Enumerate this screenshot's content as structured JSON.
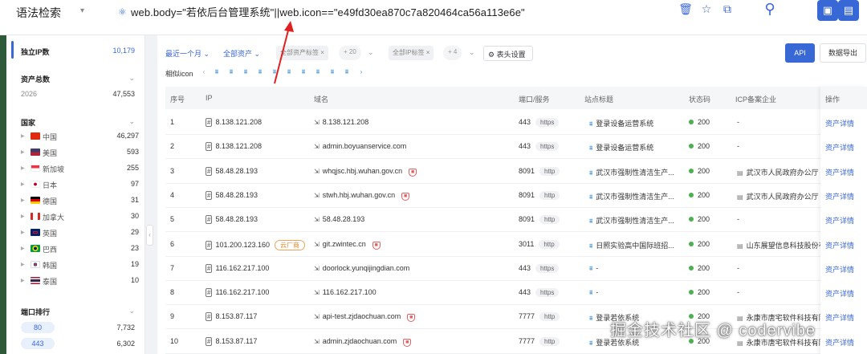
{
  "topbar": {
    "label": "语法检索",
    "query": "web.body=\"若依后台管理系统\"||web.icon==\"e49fd30ea870c7a820464ca56a113e6e\"",
    "icons": [
      "delete-icon",
      "star-icon",
      "copy-icon",
      "search-icon",
      "user-card-icon",
      "document-icon"
    ]
  },
  "sidebar": {
    "unique_ip_label": "独立IP数",
    "unique_ip_value": "10,179",
    "asset_total_label": "资产总数",
    "asset_year": "2026",
    "asset_total_value": "47,553",
    "country_label": "国家",
    "countries": [
      {
        "name": "中国",
        "count": "46,297"
      },
      {
        "name": "美国",
        "count": "593"
      },
      {
        "name": "新加坡",
        "count": "255"
      },
      {
        "name": "日本",
        "count": "97"
      },
      {
        "name": "德国",
        "count": "31"
      },
      {
        "name": "加拿大",
        "count": "30"
      },
      {
        "name": "英国",
        "count": "29"
      },
      {
        "name": "巴西",
        "count": "23"
      },
      {
        "name": "韩国",
        "count": "19"
      },
      {
        "name": "泰国",
        "count": "10"
      }
    ],
    "port_label": "端口排行",
    "ports": [
      {
        "port": "80",
        "count": "7,732"
      },
      {
        "port": "443",
        "count": "6,302"
      }
    ]
  },
  "filters": {
    "time": "最近一个月",
    "asset": "全部资产",
    "asset_tag": "全部资产标签",
    "asset_tag_count": "+ 20",
    "ip_tag": "全部IP标签",
    "ip_tag_count": "+ 4",
    "column_settings": "表头设置",
    "api": "API",
    "export": "数据导出",
    "similar_icon": "相似icon"
  },
  "table": {
    "headers": [
      "序号",
      "IP",
      "域名",
      "端口/服务",
      "站点标题",
      "状态码",
      "ICP备案企业",
      "操作"
    ],
    "rows": [
      {
        "no": "1",
        "ip": "8.138.121.208",
        "cloud": "",
        "domain": "8.138.121.208",
        "shield": false,
        "port": "443",
        "proto": "https",
        "title": "登录设备运营系统",
        "status": "200",
        "icp": "-",
        "action": "资产详情"
      },
      {
        "no": "2",
        "ip": "8.138.121.208",
        "cloud": "",
        "domain": "admin.boyuanservice.com",
        "shield": false,
        "port": "443",
        "proto": "https",
        "title": "登录设备运营系统",
        "status": "200",
        "icp": "-",
        "action": "资产详情"
      },
      {
        "no": "3",
        "ip": "58.48.28.193",
        "cloud": "",
        "domain": "whqjsc.hbj.wuhan.gov.cn",
        "shield": true,
        "port": "8091",
        "proto": "http",
        "title": "武汉市强制性清洁生产...",
        "status": "200",
        "icp": "武汉市人民政府办公厅",
        "action": "资产详情"
      },
      {
        "no": "4",
        "ip": "58.48.28.193",
        "cloud": "",
        "domain": "stwh.hbj.wuhan.gov.cn",
        "shield": true,
        "port": "8091",
        "proto": "http",
        "title": "武汉市强制性清洁生产...",
        "status": "200",
        "icp": "武汉市人民政府办公厅",
        "action": "资产详情"
      },
      {
        "no": "5",
        "ip": "58.48.28.193",
        "cloud": "",
        "domain": "58.48.28.193",
        "shield": false,
        "port": "8091",
        "proto": "http",
        "title": "武汉市强制性清洁生产...",
        "status": "200",
        "icp": "-",
        "action": "资产详情"
      },
      {
        "no": "6",
        "ip": "101.200.123.160",
        "cloud": "云厂商",
        "domain": "git.zwintec.cn",
        "shield": true,
        "port": "3011",
        "proto": "http",
        "title": "日照实验高中国际班招...",
        "status": "200",
        "icp": "山东展望信息科技股份有",
        "action": "资产详情"
      },
      {
        "no": "7",
        "ip": "116.162.217.100",
        "cloud": "",
        "domain": "doorlock.yunqijingdian.com",
        "shield": false,
        "port": "443",
        "proto": "https",
        "title": "-",
        "status": "200",
        "icp": "-",
        "action": "资产详情"
      },
      {
        "no": "8",
        "ip": "116.162.217.100",
        "cloud": "",
        "domain": "116.162.217.100",
        "shield": false,
        "port": "443",
        "proto": "https",
        "title": "-",
        "status": "200",
        "icp": "-",
        "action": "资产详情"
      },
      {
        "no": "9",
        "ip": "8.153.87.117",
        "cloud": "",
        "domain": "api-test.zjdaochuan.com",
        "shield": true,
        "port": "7777",
        "proto": "http",
        "title": "登录若依系统",
        "status": "200",
        "icp": "永康市唐宅软件科技有限",
        "action": "资产详情"
      },
      {
        "no": "10",
        "ip": "8.153.87.117",
        "cloud": "",
        "domain": "admin.zjdaochuan.com",
        "shield": true,
        "port": "7777",
        "proto": "http",
        "title": "登录若依系统",
        "status": "200",
        "icp": "永康市唐宅软件科技有限",
        "action": "资产详情"
      }
    ]
  },
  "watermark": "掘金技术社区 @ codervibe",
  "colors": {
    "accent": "#3867d6",
    "annotation": "#e02020",
    "status_ok": "#4caf50"
  }
}
